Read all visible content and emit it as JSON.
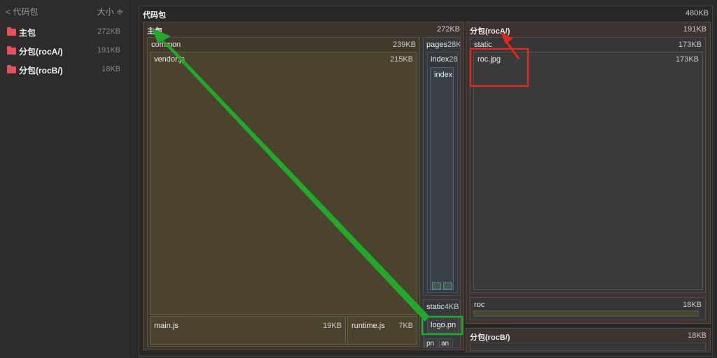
{
  "sidebar": {
    "title": "< 代码包",
    "sort_label": "大小 ≑",
    "items": [
      {
        "name": "主包",
        "size": "272KB"
      },
      {
        "name": "分包(rocA/)",
        "size": "191KB"
      },
      {
        "name": "分包(rocB/)",
        "size": "18KB"
      }
    ]
  },
  "treemap": {
    "root": {
      "label": "代码包",
      "size": "480KB"
    },
    "main": {
      "label": "主包",
      "size": "272KB"
    },
    "common": {
      "label": "common",
      "size": "239KB"
    },
    "vendor": {
      "label": "vendor.js",
      "size": "215KB"
    },
    "mainjs": {
      "label": "main.js",
      "size": "19KB"
    },
    "runtime": {
      "label": "runtime.js",
      "size": "7KB"
    },
    "pages": {
      "label": "pages",
      "size": "28K"
    },
    "index_outer": {
      "label": "index",
      "size": "28"
    },
    "index_inner": {
      "label": "index"
    },
    "static_main": {
      "label": "static",
      "size": "4KB"
    },
    "logo": {
      "label": "logo.pn"
    },
    "pn_a": {
      "label": "pn"
    },
    "pn_b": {
      "label": "an"
    },
    "rocA": {
      "label": "分包(rocA/)",
      "size": "191KB"
    },
    "staticA": {
      "label": "static",
      "size": "173KB"
    },
    "rocjpg": {
      "label": "roc.jpg",
      "size": "173KB"
    },
    "roc": {
      "label": "roc",
      "size": "18KB"
    },
    "rocB": {
      "label": "分包(rocB/)",
      "size": "18KB"
    }
  },
  "annotation_colors": {
    "green": "#22a82a",
    "red": "#e0281e"
  }
}
